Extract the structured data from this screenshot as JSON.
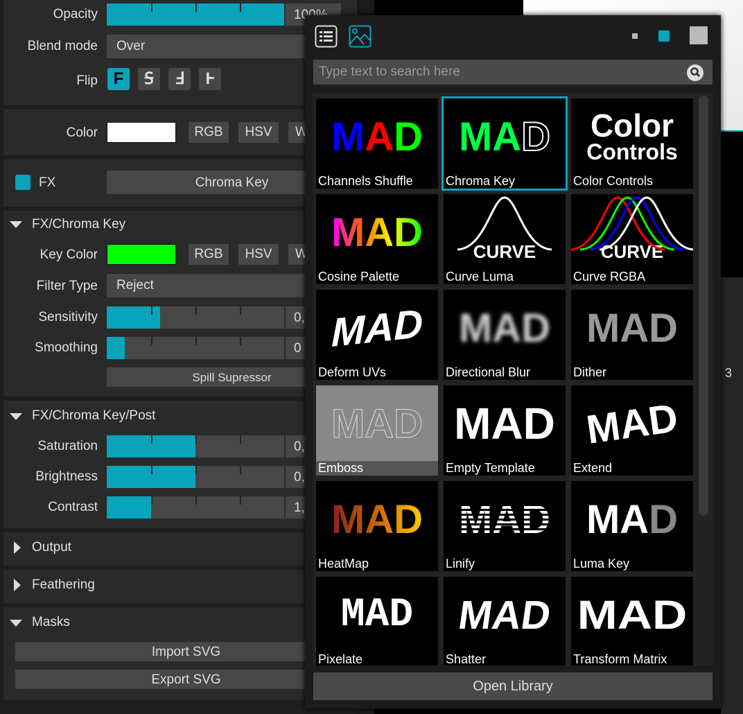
{
  "colors": {
    "accent": "#08a4bc",
    "key_color": "#00ff00",
    "color": "#ffffff"
  },
  "layer": {
    "opacity": {
      "label": "Opacity",
      "value": "100%",
      "fraction": 1.0
    },
    "blend_mode": {
      "label": "Blend mode",
      "value": "Over"
    },
    "flip": {
      "label": "Flip",
      "options": [
        "F",
        "Ꟊ",
        "Ⅎ",
        "Ⱶ"
      ],
      "selected": 0
    },
    "color": {
      "label": "Color",
      "buttons": [
        "RGB",
        "HSV",
        "W"
      ]
    },
    "fx": {
      "label": "FX",
      "value": "Chroma Key",
      "enabled": true
    }
  },
  "chroma_key": {
    "title": "FX/Chroma Key",
    "key_color_label": "Key Color",
    "key_buttons": [
      "RGB",
      "HSV",
      "W"
    ],
    "filter_type": {
      "label": "Filter Type",
      "value": "Reject"
    },
    "sensitivity": {
      "label": "Sensitivity",
      "value": "0,",
      "fraction": 0.3
    },
    "smoothing": {
      "label": "Smoothing",
      "value": "0",
      "fraction": 0.1
    },
    "spill_button": "Spill Supressor"
  },
  "post": {
    "title": "FX/Chroma Key/Post",
    "saturation": {
      "label": "Saturation",
      "value": "0,",
      "fraction": 0.5
    },
    "brightness": {
      "label": "Brightness",
      "value": "0,",
      "fraction": 0.5
    },
    "contrast": {
      "label": "Contrast",
      "value": "1,",
      "fraction": 0.25
    }
  },
  "sections": {
    "output": "Output",
    "feathering": "Feathering",
    "masks": "Masks",
    "import_svg": "Import SVG",
    "export_svg": "Export SVG"
  },
  "background": {
    "value": "3"
  },
  "library": {
    "search_placeholder": "Type text to search here",
    "open_library": "Open Library",
    "selected": "Chroma Key",
    "items": [
      {
        "name": "Channels Shuffle",
        "thumb": "MAD"
      },
      {
        "name": "Chroma Key",
        "thumb": "MAD"
      },
      {
        "name": "Color Controls",
        "thumb": "Color Controls"
      },
      {
        "name": "Cosine Palette",
        "thumb": "MAD"
      },
      {
        "name": "Curve Luma",
        "thumb": "CURVE"
      },
      {
        "name": "Curve RGBA",
        "thumb": "CURVE"
      },
      {
        "name": "Deform UVs",
        "thumb": "MAD"
      },
      {
        "name": "Directional Blur",
        "thumb": "MAD"
      },
      {
        "name": "Dither",
        "thumb": "MAD"
      },
      {
        "name": "Emboss",
        "thumb": "MAD"
      },
      {
        "name": "Empty Template",
        "thumb": "MAD"
      },
      {
        "name": "Extend",
        "thumb": "MAD"
      },
      {
        "name": "HeatMap",
        "thumb": "MAD"
      },
      {
        "name": "Linify",
        "thumb": "MAD"
      },
      {
        "name": "Luma Key",
        "thumb": "MAD"
      },
      {
        "name": "Pixelate",
        "thumb": "MAD"
      },
      {
        "name": "Shatter",
        "thumb": "MAD"
      },
      {
        "name": "Transform Matrix",
        "thumb": "MAD"
      }
    ]
  }
}
